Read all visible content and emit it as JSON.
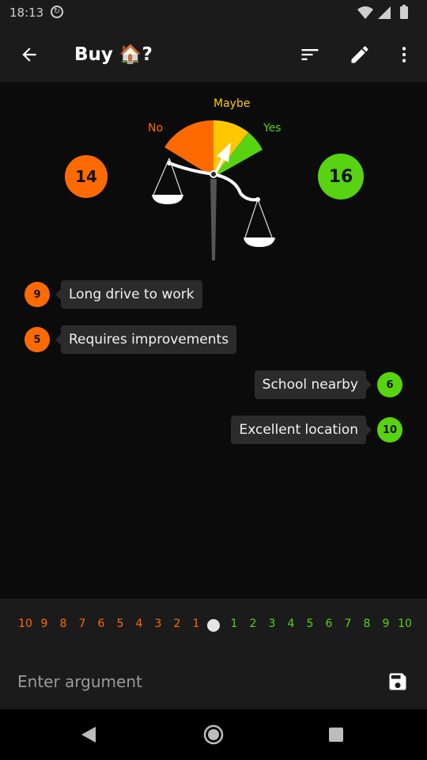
{
  "status": {
    "time": "18:13"
  },
  "appbar": {
    "title": "Buy 🏠?"
  },
  "gauge": {
    "label_no": "No",
    "label_maybe": "Maybe",
    "label_yes": "Yes"
  },
  "scores": {
    "no": "14",
    "yes": "16"
  },
  "arguments": [
    {
      "side": "against",
      "weight": "9",
      "text": "Long drive to work"
    },
    {
      "side": "against",
      "weight": "5",
      "text": "Requires improvements"
    },
    {
      "side": "for",
      "weight": "6",
      "text": "School nearby"
    },
    {
      "side": "for",
      "weight": "10",
      "text": "Excellent location"
    }
  ],
  "weights": {
    "negative": [
      "10",
      "9",
      "8",
      "7",
      "6",
      "5",
      "4",
      "3",
      "2",
      "1"
    ],
    "positive": [
      "1",
      "2",
      "3",
      "4",
      "5",
      "6",
      "7",
      "8",
      "9",
      "10"
    ]
  },
  "input": {
    "placeholder": "Enter argument",
    "value": ""
  },
  "colors": {
    "against": "#ff6a00",
    "maybe": "#ffc700",
    "for": "#58d312"
  }
}
